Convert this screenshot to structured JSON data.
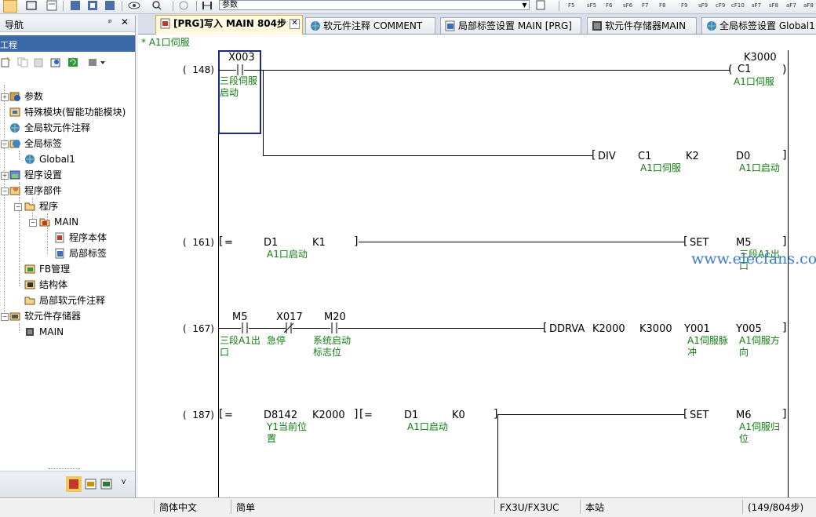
{
  "toolbar": {
    "combo_value": "参数",
    "fkeys": [
      "F5",
      "sF5",
      "F6",
      "sF6",
      "F7",
      "F8",
      "F9",
      "sF9",
      "cF9",
      "cF10",
      "sF7",
      "sF8",
      "aF7",
      "aF8"
    ]
  },
  "nav": {
    "title": "导航",
    "pin": "ᵖ",
    "close": "✕",
    "project_header": "工程",
    "tree": [
      {
        "label": "参数"
      },
      {
        "label": "特殊模块(智能功能模块)"
      },
      {
        "label": "全局软元件注释"
      },
      {
        "label": "全局标签"
      },
      {
        "label": "Global1"
      },
      {
        "label": "程序设置"
      },
      {
        "label": "程序部件"
      },
      {
        "label": "程序"
      },
      {
        "label": "MAIN"
      },
      {
        "label": "程序本体"
      },
      {
        "label": "局部标签"
      },
      {
        "label": "FB管理"
      },
      {
        "label": "结构体"
      },
      {
        "label": "局部软元件注释"
      },
      {
        "label": "软元件存储器"
      },
      {
        "label": "MAIN"
      }
    ]
  },
  "tabs": [
    {
      "label": "[PRG]写入 MAIN 804步",
      "active": true
    },
    {
      "label": "软元件注释 COMMENT"
    },
    {
      "label": "局部标签设置 MAIN [PRG]"
    },
    {
      "label": "软元件存储器MAIN"
    },
    {
      "label": "全局标签设置 Global1"
    }
  ],
  "ladder": {
    "header_comment": "* A1口伺服",
    "watermark": "www.elecfans.com",
    "rungs": [
      {
        "step": "148"
      },
      {
        "step": "161"
      },
      {
        "step": "167"
      },
      {
        "step": "187"
      }
    ],
    "r148": {
      "contact": "X003",
      "contact_comment": "三段伺服启动",
      "coil_k": "K3000",
      "coil": "C1",
      "coil_comment": "A1口伺服",
      "div_op": "DIV",
      "div_s1": "C1",
      "div_s1_comment": "A1口伺服",
      "div_s2": "K2",
      "div_d": "D0",
      "div_d_comment": "A1口启动"
    },
    "r161": {
      "cmp_op": "=",
      "cmp_s1": "D1",
      "cmp_s1_comment": "A1口启动",
      "cmp_s2": "K1",
      "set_op": "SET",
      "set_d": "M5",
      "set_d_comment": "三段A1出口"
    },
    "r167": {
      "c1": "M5",
      "c1_comment": "三段A1出口",
      "c2": "X017",
      "c2_comment": "急停",
      "c3": "M20",
      "c3_comment": "系统启动标志位",
      "op": "DDRVA",
      "s1": "K2000",
      "s2": "K3000",
      "d1": "Y001",
      "d1_comment": "A1伺服脉冲",
      "d2": "Y005",
      "d2_comment": "A1伺服方向"
    },
    "r187": {
      "cmp1_op": "=",
      "cmp1_s1": "D8142",
      "cmp1_s1_comment": "Y1当前位置",
      "cmp1_s2": "K2000",
      "cmp2_op": "=",
      "cmp2_s1": "D1",
      "cmp2_s1_comment": "A1口启动",
      "cmp2_s2": "K0",
      "set_op": "SET",
      "set_d": "M6",
      "set_d_comment": "A1伺服归位"
    }
  },
  "status": {
    "lang": "简体中文",
    "mode": "简单",
    "plc": "FX3U/FX3UC",
    "station": "本站",
    "steps": "(149/804步)"
  }
}
